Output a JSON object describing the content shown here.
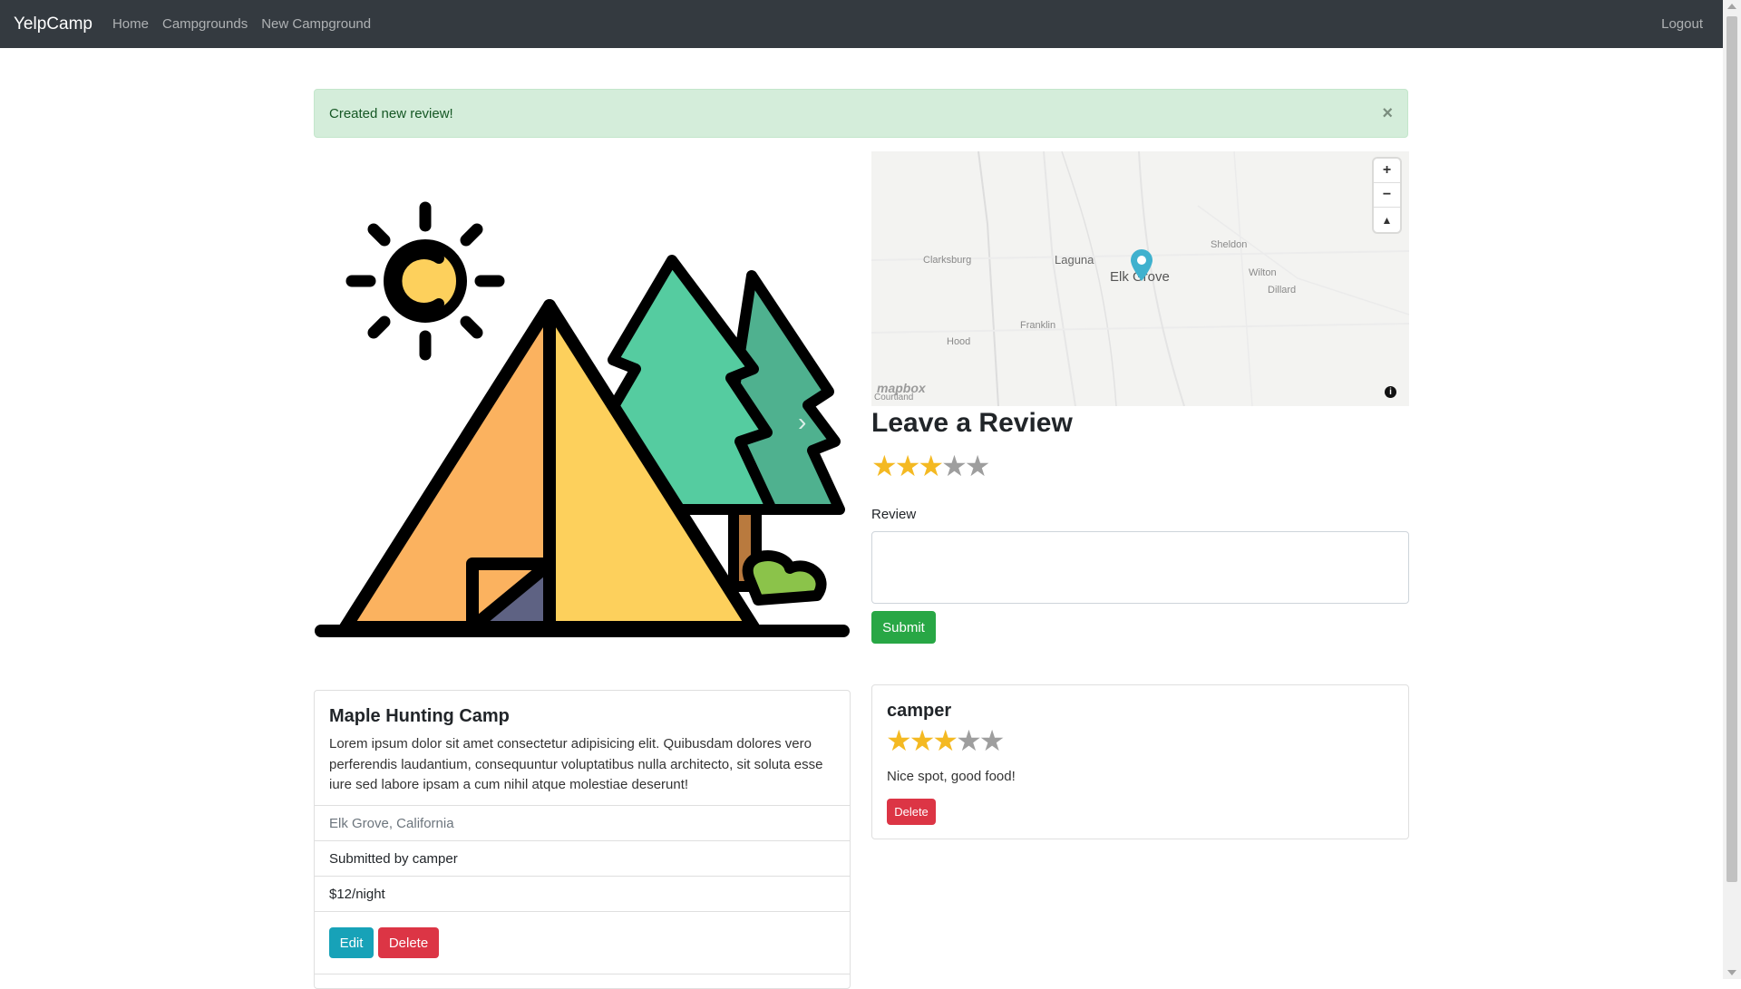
{
  "navbar": {
    "brand": "YelpCamp",
    "links": [
      "Home",
      "Campgrounds",
      "New Campground"
    ],
    "logout": "Logout"
  },
  "alert": {
    "message": "Created new review!",
    "close": "×"
  },
  "map": {
    "labels": {
      "clarksburg": "Clarksburg",
      "laguna": "Laguna",
      "elk_grove": "Elk Grove",
      "sheldon": "Sheldon",
      "wilton": "Wilton",
      "dillard": "Dillard",
      "franklin": "Franklin",
      "hood": "Hood",
      "courtland": "Courtland"
    },
    "zoom_in": "+",
    "zoom_out": "−",
    "compass": "▲",
    "attribution_logo": "mapbox",
    "info": "i"
  },
  "review_form": {
    "title": "Leave a Review",
    "rating": 3,
    "rating_max": 5,
    "review_label": "Review",
    "review_value": "",
    "submit_label": "Submit"
  },
  "campground": {
    "title": "Maple Hunting Camp",
    "description": "Lorem ipsum dolor sit amet consectetur adipisicing elit. Quibusdam dolores vero perferendis laudantium, consequuntur voluptatibus nulla architecto, sit soluta esse iure sed labore ipsam a cum nihil atque molestiae deserunt!",
    "location": "Elk Grove, California",
    "submitted_by": "Submitted by camper",
    "price": "$12/night",
    "edit_label": "Edit",
    "delete_label": "Delete"
  },
  "reviews": [
    {
      "author": "camper",
      "rating": 3,
      "text": "Nice spot, good food!",
      "delete_label": "Delete"
    }
  ],
  "colors": {
    "navbar": "#343a40",
    "alert_bg": "#d4edda",
    "success": "#28a745",
    "info": "#17a2b8",
    "danger": "#dc3545",
    "star_on": "#f4b922",
    "star_off": "#9e9e9e"
  },
  "icons": {
    "close": "close-icon",
    "carousel_next": "chevron-right-icon",
    "map_marker": "map-pin-icon",
    "star": "star-icon",
    "map_info": "info-icon"
  }
}
